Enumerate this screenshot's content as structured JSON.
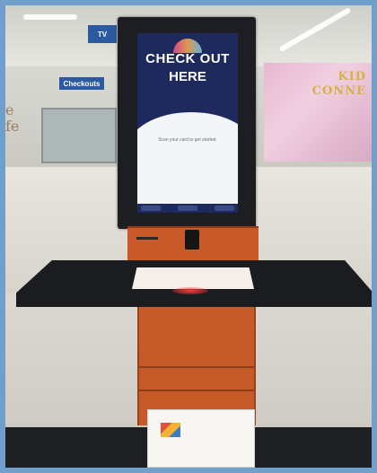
{
  "scene": {
    "description_free": true
  },
  "kiosk_screen": {
    "title_line1": "CHECK OUT",
    "title_line2": "HERE",
    "instruction": "Scan your card to get started."
  },
  "wall_text": {
    "left": "e\nfe",
    "mural": "KID\nCONNE"
  },
  "signs": {
    "sign1": "TV",
    "sign2": "Checkouts"
  },
  "colors": {
    "screen_header": "#1e2a5e",
    "kiosk_wood": "#c85a2a",
    "desk": "#1b1c1f",
    "frame": "#6f9fca"
  }
}
